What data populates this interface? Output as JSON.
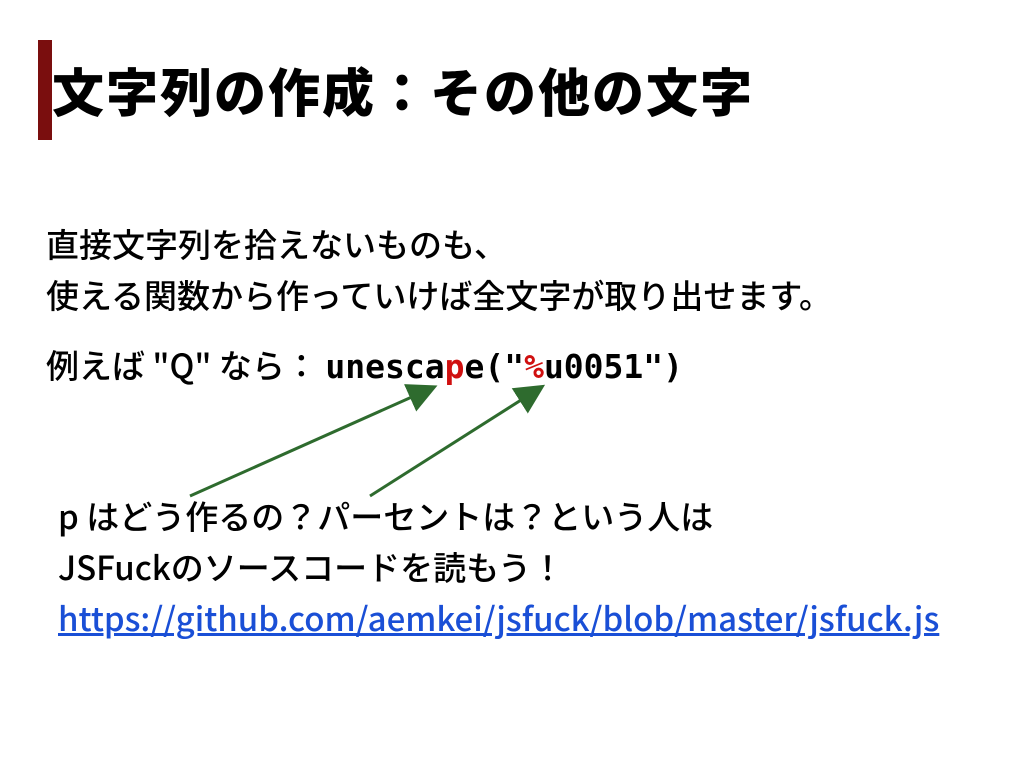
{
  "title": "文字列の作成：その他の文字",
  "para1_line1": "直接文字列を拾えないものも、",
  "para1_line2": "使える関数から作っていけば全文字が取り出せます。",
  "example_prefix": "例えば \"Q\" なら：",
  "example_code_1": "unesca",
  "example_code_p": "p",
  "example_code_2": "e(\"",
  "example_code_pct": "%",
  "example_code_3": "u0051\")",
  "para3_line1": "p はどう作るの？パーセントは？という人は",
  "para3_line2": "JSFuckのソースコードを読もう！",
  "link_text": "https://github.com/aemkei/jsfuck/blob/master/jsfuck.js",
  "link_href": "https://github.com/aemkei/jsfuck/blob/master/jsfuck.js",
  "colors": {
    "accent": "#7a0e0e",
    "link": "#1a4fd6",
    "code_red": "#d01010",
    "arrow": "#2e6b2e"
  }
}
